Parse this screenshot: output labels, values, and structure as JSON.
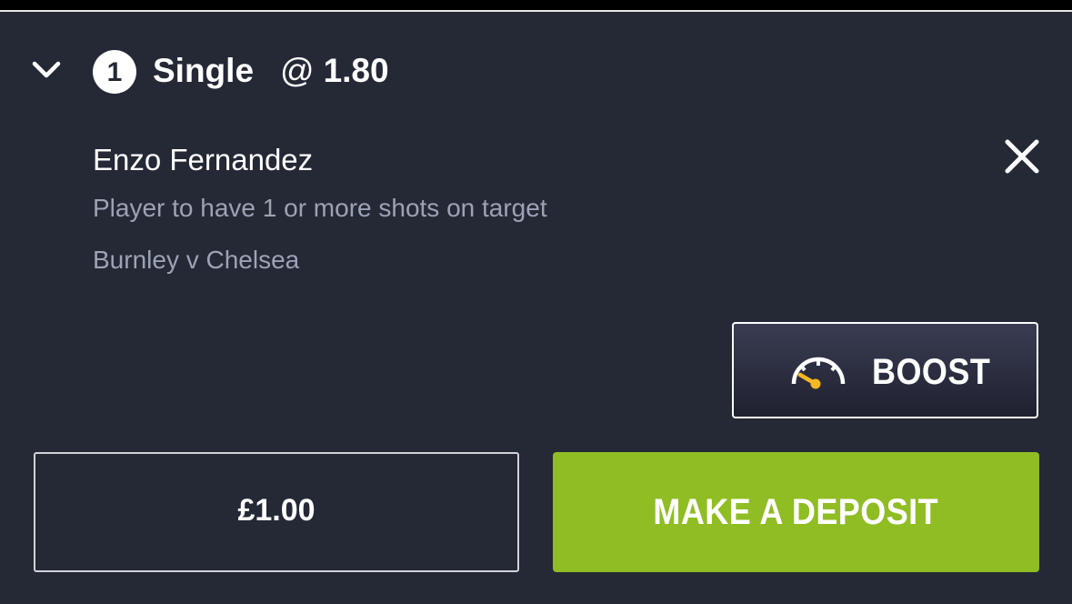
{
  "bet": {
    "count": "1",
    "type": "Single",
    "odds_prefix": "@",
    "odds": "1.80"
  },
  "selection": {
    "name": "Enzo Fernandez",
    "market": "Player to have 1 or more shots on target",
    "event": "Burnley v Chelsea"
  },
  "boost": {
    "label": "BOOST",
    "icon": "speedometer-icon"
  },
  "stake": {
    "value": "£1.00"
  },
  "deposit": {
    "label": "MAKE A DEPOSIT"
  },
  "colors": {
    "background": "#252835",
    "secondary_text": "#9ca3b4",
    "deposit_green": "#8fbd23",
    "boost_accent": "#f5b820"
  }
}
